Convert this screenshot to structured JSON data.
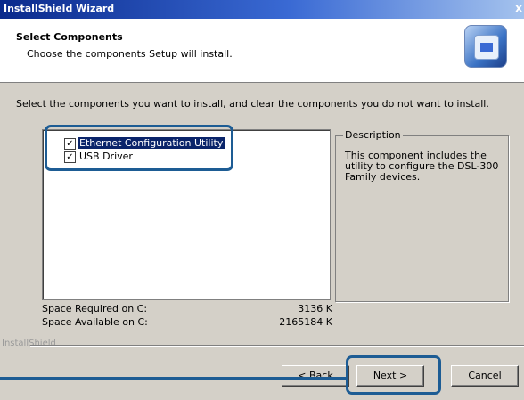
{
  "window": {
    "title": "InstallShield Wizard",
    "close_glyph": "x"
  },
  "header": {
    "title": "Select Components",
    "subtitle": "Choose the components Setup will install.",
    "logo_icon": "installshield-computer-icon"
  },
  "instructions": "Select the components you want to install, and clear the components you do not want to install.",
  "components": [
    {
      "label": "Ethernet Configuration Utility",
      "checked": true,
      "selected": true
    },
    {
      "label": "USB Driver",
      "checked": true,
      "selected": false
    }
  ],
  "description": {
    "legend": "Description",
    "text": "This component includes the utility to configure the DSL-300 Family devices."
  },
  "space": {
    "required_label": "Space Required on  C:",
    "required_value": "3136 K",
    "available_label": "Space Available on  C:",
    "available_value": "2165184 K"
  },
  "brand": "InstallShield",
  "buttons": {
    "back_label": "< Back",
    "next_label": "Next >",
    "cancel_label": "Cancel"
  },
  "colors": {
    "highlight": "#1d5c94",
    "selection": "#0a246a"
  }
}
